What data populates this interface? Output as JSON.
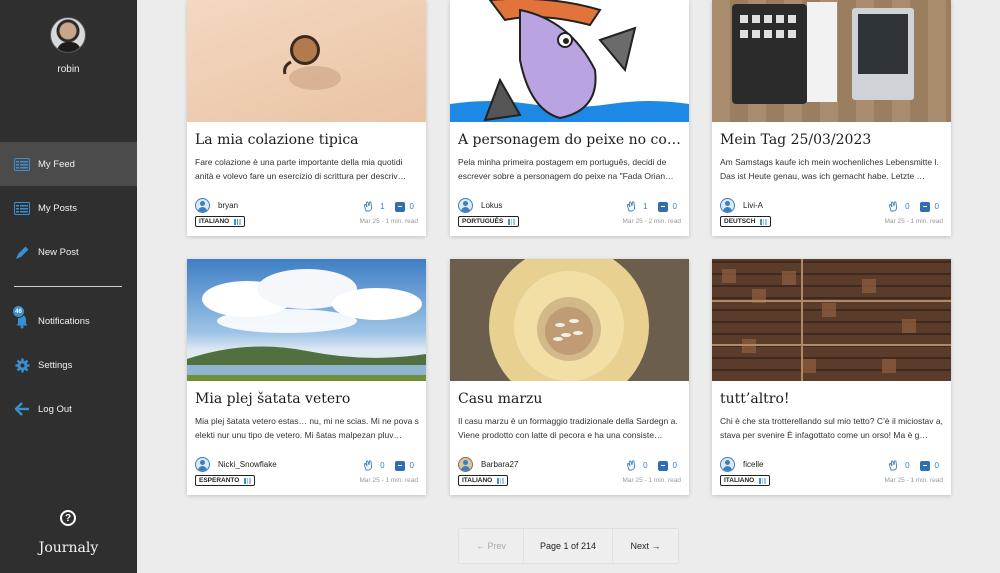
{
  "sidebar": {
    "username": "robin",
    "items": [
      {
        "label": "My Feed"
      },
      {
        "label": "My Posts"
      },
      {
        "label": "New Post"
      },
      {
        "label": "Notifications",
        "badge": "46"
      },
      {
        "label": "Settings"
      },
      {
        "label": "Log Out"
      }
    ],
    "brand": "Journaly"
  },
  "cards": [
    {
      "title": "La mia colazione tipica",
      "excerpt": "Fare colazione è una parte importante della mia quotidi anità e volevo fare un esercizio di scrittura per descriv…",
      "author": "bryan",
      "language": "ITALIANO",
      "likes": "1",
      "comments": "0",
      "meta": "Mar 25 - 1 min. read"
    },
    {
      "title": "A personagem do peixe no conto…",
      "excerpt": "Pela minha primeira postagem em português, decidi de escrever sobre a personagem do peixe na \"Fada Orian…",
      "author": "Lokus",
      "language": "PORTUGUÊS",
      "likes": "1",
      "comments": "0",
      "meta": "Mar 25 - 2 min. read"
    },
    {
      "title": "Mein Tag 25/03/2023",
      "excerpt": "Am Samstags kaufe ich mein wochenliches Lebensmitte l. Das ist Heute genau, was ich gemacht habe. Letzte …",
      "author": "Livi-A",
      "language": "DEUTSCH",
      "likes": "0",
      "comments": "0",
      "meta": "Mar 25 - 1 min. read"
    },
    {
      "title": "Mia plej šatata vetero",
      "excerpt": "Mia plej šatata vetero estas… nu, mi ne scias. Mi ne pova s elekti nur unu tipo de vetero. Mi šatas malpezan pluv…",
      "author": "Nicki_Snowflake",
      "language": "ESPERANTO",
      "likes": "0",
      "comments": "0",
      "meta": "Mar 25 - 1 min. read"
    },
    {
      "title": "Casu marzu",
      "excerpt": "Il casu marzu è un formaggio tradizionale della Sardegn a. Viene prodotto con latte di pecora e ha una consiste…",
      "author": "Barbara27",
      "language": "ITALIANO",
      "likes": "0",
      "comments": "0",
      "meta": "Mar 25 - 1 min. read"
    },
    {
      "title": "tutt’altro!",
      "excerpt": "Chi è che sta trotterellando sul mio tetto? C’è il miciostav a, stava per svenire È infagottato come un orso! Ma è g…",
      "author": "ficelle",
      "language": "ITALIANO",
      "likes": "0",
      "comments": "0",
      "meta": "Mar 25 - 1 min. read"
    }
  ],
  "pagination": {
    "prev": "← Prev",
    "page": "Page 1 of 214",
    "next": "Next →"
  },
  "colors": {
    "sidebar": "#2f2f2f",
    "accent": "#3a8fd0",
    "background": "#ececec"
  }
}
